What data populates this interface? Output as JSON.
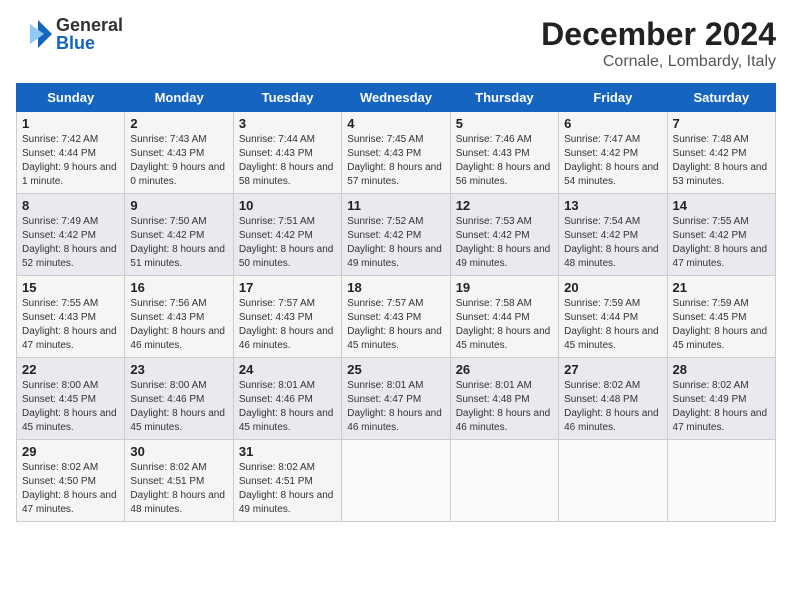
{
  "header": {
    "logo_line1": "General",
    "logo_line2": "Blue",
    "title": "December 2024",
    "subtitle": "Cornale, Lombardy, Italy"
  },
  "weekdays": [
    "Sunday",
    "Monday",
    "Tuesday",
    "Wednesday",
    "Thursday",
    "Friday",
    "Saturday"
  ],
  "weeks": [
    [
      {
        "day": "1",
        "sunrise": "7:42 AM",
        "sunset": "4:44 PM",
        "daylight": "9 hours and 1 minute."
      },
      {
        "day": "2",
        "sunrise": "7:43 AM",
        "sunset": "4:43 PM",
        "daylight": "9 hours and 0 minutes."
      },
      {
        "day": "3",
        "sunrise": "7:44 AM",
        "sunset": "4:43 PM",
        "daylight": "8 hours and 58 minutes."
      },
      {
        "day": "4",
        "sunrise": "7:45 AM",
        "sunset": "4:43 PM",
        "daylight": "8 hours and 57 minutes."
      },
      {
        "day": "5",
        "sunrise": "7:46 AM",
        "sunset": "4:43 PM",
        "daylight": "8 hours and 56 minutes."
      },
      {
        "day": "6",
        "sunrise": "7:47 AM",
        "sunset": "4:42 PM",
        "daylight": "8 hours and 54 minutes."
      },
      {
        "day": "7",
        "sunrise": "7:48 AM",
        "sunset": "4:42 PM",
        "daylight": "8 hours and 53 minutes."
      }
    ],
    [
      {
        "day": "8",
        "sunrise": "7:49 AM",
        "sunset": "4:42 PM",
        "daylight": "8 hours and 52 minutes."
      },
      {
        "day": "9",
        "sunrise": "7:50 AM",
        "sunset": "4:42 PM",
        "daylight": "8 hours and 51 minutes."
      },
      {
        "day": "10",
        "sunrise": "7:51 AM",
        "sunset": "4:42 PM",
        "daylight": "8 hours and 50 minutes."
      },
      {
        "day": "11",
        "sunrise": "7:52 AM",
        "sunset": "4:42 PM",
        "daylight": "8 hours and 49 minutes."
      },
      {
        "day": "12",
        "sunrise": "7:53 AM",
        "sunset": "4:42 PM",
        "daylight": "8 hours and 49 minutes."
      },
      {
        "day": "13",
        "sunrise": "7:54 AM",
        "sunset": "4:42 PM",
        "daylight": "8 hours and 48 minutes."
      },
      {
        "day": "14",
        "sunrise": "7:55 AM",
        "sunset": "4:42 PM",
        "daylight": "8 hours and 47 minutes."
      }
    ],
    [
      {
        "day": "15",
        "sunrise": "7:55 AM",
        "sunset": "4:43 PM",
        "daylight": "8 hours and 47 minutes."
      },
      {
        "day": "16",
        "sunrise": "7:56 AM",
        "sunset": "4:43 PM",
        "daylight": "8 hours and 46 minutes."
      },
      {
        "day": "17",
        "sunrise": "7:57 AM",
        "sunset": "4:43 PM",
        "daylight": "8 hours and 46 minutes."
      },
      {
        "day": "18",
        "sunrise": "7:57 AM",
        "sunset": "4:43 PM",
        "daylight": "8 hours and 45 minutes."
      },
      {
        "day": "19",
        "sunrise": "7:58 AM",
        "sunset": "4:44 PM",
        "daylight": "8 hours and 45 minutes."
      },
      {
        "day": "20",
        "sunrise": "7:59 AM",
        "sunset": "4:44 PM",
        "daylight": "8 hours and 45 minutes."
      },
      {
        "day": "21",
        "sunrise": "7:59 AM",
        "sunset": "4:45 PM",
        "daylight": "8 hours and 45 minutes."
      }
    ],
    [
      {
        "day": "22",
        "sunrise": "8:00 AM",
        "sunset": "4:45 PM",
        "daylight": "8 hours and 45 minutes."
      },
      {
        "day": "23",
        "sunrise": "8:00 AM",
        "sunset": "4:46 PM",
        "daylight": "8 hours and 45 minutes."
      },
      {
        "day": "24",
        "sunrise": "8:01 AM",
        "sunset": "4:46 PM",
        "daylight": "8 hours and 45 minutes."
      },
      {
        "day": "25",
        "sunrise": "8:01 AM",
        "sunset": "4:47 PM",
        "daylight": "8 hours and 46 minutes."
      },
      {
        "day": "26",
        "sunrise": "8:01 AM",
        "sunset": "4:48 PM",
        "daylight": "8 hours and 46 minutes."
      },
      {
        "day": "27",
        "sunrise": "8:02 AM",
        "sunset": "4:48 PM",
        "daylight": "8 hours and 46 minutes."
      },
      {
        "day": "28",
        "sunrise": "8:02 AM",
        "sunset": "4:49 PM",
        "daylight": "8 hours and 47 minutes."
      }
    ],
    [
      {
        "day": "29",
        "sunrise": "8:02 AM",
        "sunset": "4:50 PM",
        "daylight": "8 hours and 47 minutes."
      },
      {
        "day": "30",
        "sunrise": "8:02 AM",
        "sunset": "4:51 PM",
        "daylight": "8 hours and 48 minutes."
      },
      {
        "day": "31",
        "sunrise": "8:02 AM",
        "sunset": "4:51 PM",
        "daylight": "8 hours and 49 minutes."
      },
      null,
      null,
      null,
      null
    ]
  ]
}
